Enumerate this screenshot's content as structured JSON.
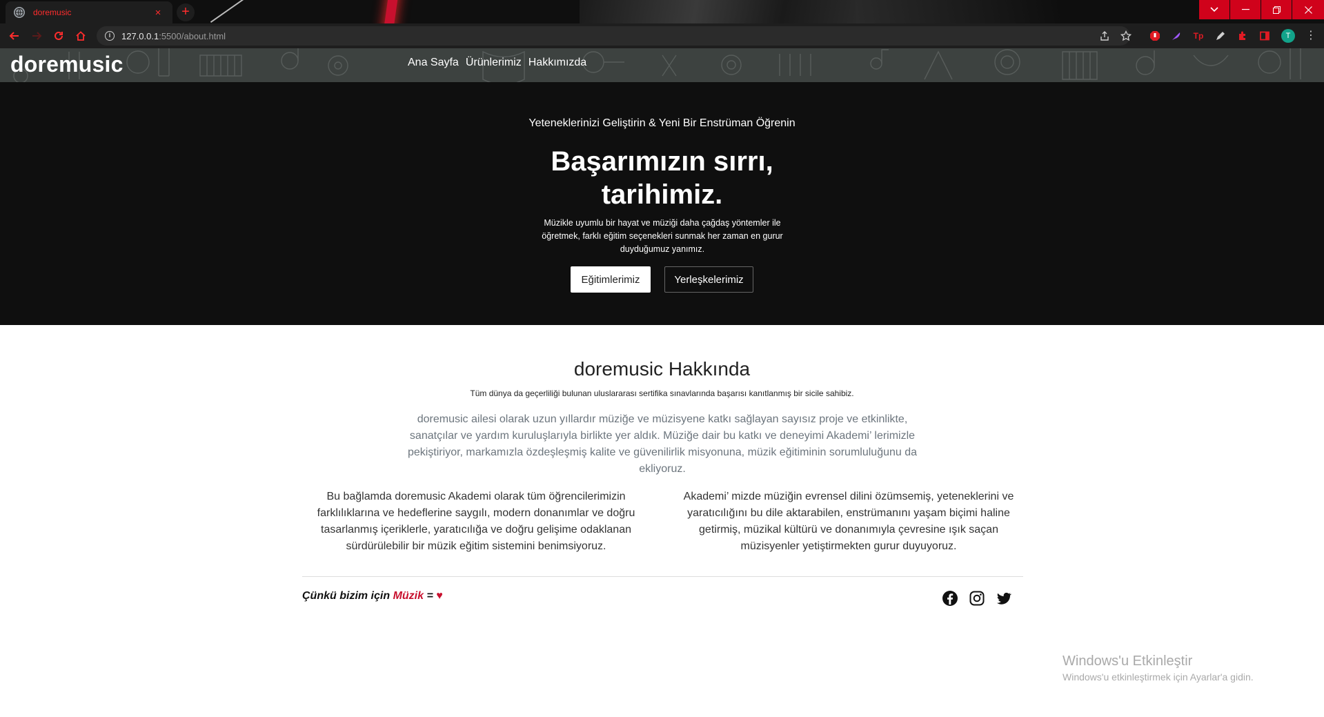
{
  "browser": {
    "tab_title": "doremusic",
    "tab_close": "×",
    "new_tab": "+",
    "url_host": "127.0.0.1",
    "url_path": ":5500/about.html",
    "profile_initial": "T",
    "accent_color": "#ff2d2d",
    "window_control_color": "#d0021b"
  },
  "site": {
    "brand": "doremusic",
    "nav": [
      "Ana Sayfa",
      "Ürünlerimiz",
      "Hakkımızda"
    ]
  },
  "hero": {
    "subtitle": "Yeteneklerinizi Geliştirin & Yeni Bir Enstrüman Öğrenin",
    "title_line1": "Başarımızın sırrı,",
    "title_line2": "tarihimiz.",
    "description": "Müzikle uyumlu bir hayat ve müziği daha çağdaş yöntemler ile öğretmek, farklı eğitim seçenekleri sunmak her zaman en gurur duyduğumuz yanımız.",
    "primary_button": "Eğitimlerimiz",
    "secondary_button": "Yerleşkelerimiz"
  },
  "about": {
    "title": "doremusic Hakkında",
    "tagline": "Tüm dünya da geçerliliği bulunan uluslararası sertifika sınavlarında başarısı kanıtlanmış bir sicile sahibiz.",
    "lead": "doremusic ailesi olarak uzun yıllardır müziğe ve müzisyene katkı sağlayan sayısız proje ve etkinlikte, sanatçılar ve yardım kuruluşlarıyla birlikte yer aldık. Müziğe dair bu katkı ve deneyimi Akademi’ lerimizle pekiştiriyor, markamızla özdeşleşmiş kalite ve güvenilirlik misyonuna, müzik eğitiminin sorumluluğunu da ekliyoruz.",
    "col_left": "Bu bağlamda doremusic Akademi olarak tüm öğrencilerimizin farklılıklarına ve hedeflerine saygılı, modern donanımlar ve doğru tasarlanmış içeriklerle, yaratıcılığa ve doğru gelişime odaklanan sürdürülebilir bir müzik eğitim sistemini benimsiyoruz.",
    "col_right": "Akademi’ mizde müziğin evrensel dilini özümsemiş, yeteneklerini ve yaratıcılığını bu dile aktarabilen, enstrümanını yaşam biçimi haline getirmiş, müzikal kültürü ve donanımıyla çevresine ışık saçan müzisyenler yetiştirmekten gurur duyuyoruz."
  },
  "footer": {
    "motto_prefix": "Çünkü bizim için",
    "motto_word": "Müzik",
    "motto_equals": "=",
    "motto_heart": "♥",
    "social_icons": [
      "facebook-icon",
      "instagram-icon",
      "twitter-icon"
    ]
  },
  "watermark": {
    "title": "Windows'u Etkinleştir",
    "subtitle": "Windows'u etkinleştirmek için Ayarlar'a gidin."
  }
}
